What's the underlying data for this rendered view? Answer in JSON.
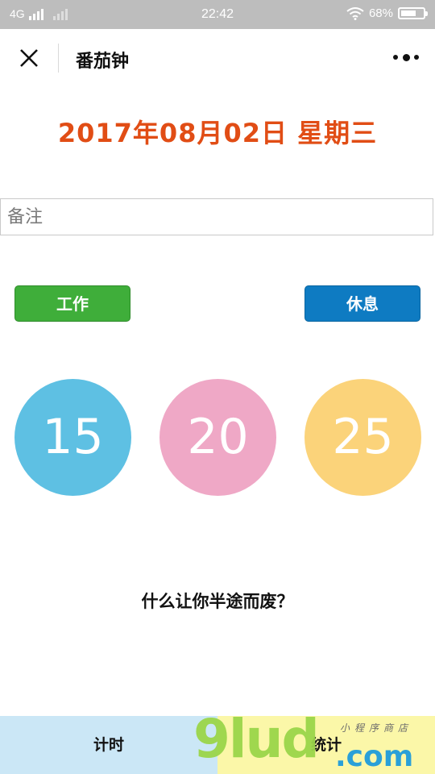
{
  "status_bar": {
    "network": "4G",
    "time": "22:42",
    "battery_percent": "68%",
    "battery_level": 0.68
  },
  "nav": {
    "title": "番茄钟",
    "close_icon": "close-icon",
    "more_icon": "more-dots-icon"
  },
  "date": "2017年08月02日 星期三",
  "note": {
    "placeholder": "备注",
    "value": ""
  },
  "modes": {
    "work_label": "工作",
    "rest_label": "休息"
  },
  "durations": [
    "15",
    "20",
    "25"
  ],
  "quote": "什么让你半途而废？",
  "tabs": {
    "timer": "计时",
    "stats": "统计"
  },
  "watermark": {
    "brand": "9lud",
    "domain": ".com",
    "tagline": "小程序商店"
  },
  "colors": {
    "date": "#e14d15",
    "work": "#3fae3a",
    "rest": "#0e7bc2",
    "circle_15": "#5ec0e3",
    "circle_20": "#efa8c6",
    "circle_25": "#fbd37a",
    "tab_timer_bg": "#cbe7f6",
    "tab_stats_bg": "#fbf7a8"
  }
}
